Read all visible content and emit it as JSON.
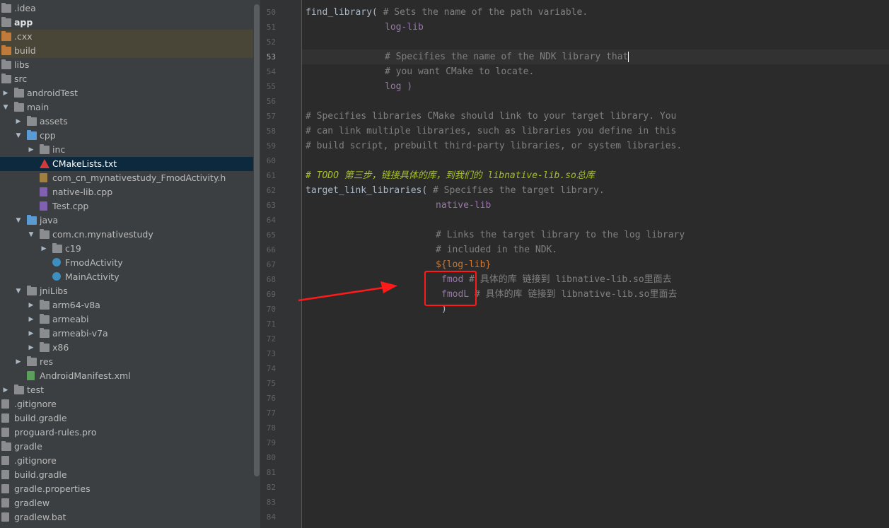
{
  "tree": {
    "items": [
      {
        "label": ".idea",
        "icon": "folder-icon",
        "arrow": ""
      },
      {
        "label": "app",
        "icon": "module-folder-icon",
        "arrow": "",
        "bold": true
      },
      {
        "label": ".cxx",
        "icon": "excluded-folder-icon",
        "arrow": ""
      },
      {
        "label": "build",
        "icon": "excluded-folder-icon",
        "arrow": ""
      },
      {
        "label": "libs",
        "icon": "folder-icon",
        "arrow": ""
      },
      {
        "label": "src",
        "icon": "folder-icon",
        "arrow": ""
      },
      {
        "label": "androidTest",
        "icon": "folder-icon",
        "arrow": "▶"
      },
      {
        "label": "main",
        "icon": "folder-icon",
        "arrow": "▼"
      },
      {
        "label": "assets",
        "icon": "resource-folder-icon",
        "arrow": "▶"
      },
      {
        "label": "cpp",
        "icon": "source-folder-icon",
        "arrow": "▼"
      },
      {
        "label": "inc",
        "icon": "package-folder-icon",
        "arrow": "▶"
      },
      {
        "label": "CMakeLists.txt",
        "icon": "cmake-icon",
        "arrow": ""
      },
      {
        "label": "com_cn_mynativestudy_FmodActivity.h",
        "icon": "header-file-icon",
        "arrow": ""
      },
      {
        "label": "native-lib.cpp",
        "icon": "cpp-file-icon",
        "arrow": ""
      },
      {
        "label": "Test.cpp",
        "icon": "cpp-file-icon",
        "arrow": ""
      },
      {
        "label": "java",
        "icon": "source-folder-icon",
        "arrow": "▼"
      },
      {
        "label": "com.cn.mynativestudy",
        "icon": "package-folder-icon",
        "arrow": "▼"
      },
      {
        "label": "c19",
        "icon": "package-folder-icon",
        "arrow": "▶"
      },
      {
        "label": "FmodActivity",
        "icon": "java-class-icon",
        "arrow": ""
      },
      {
        "label": "MainActivity",
        "icon": "java-class-icon",
        "arrow": ""
      },
      {
        "label": "jniLibs",
        "icon": "folder-icon",
        "arrow": "▼"
      },
      {
        "label": "arm64-v8a",
        "icon": "folder-icon",
        "arrow": "▶"
      },
      {
        "label": "armeabi",
        "icon": "folder-icon",
        "arrow": "▶"
      },
      {
        "label": "armeabi-v7a",
        "icon": "folder-icon",
        "arrow": "▶"
      },
      {
        "label": "x86",
        "icon": "folder-icon",
        "arrow": "▶"
      },
      {
        "label": "res",
        "icon": "resource-folder-icon",
        "arrow": "▶"
      },
      {
        "label": "AndroidManifest.xml",
        "icon": "manifest-file-icon",
        "arrow": ""
      },
      {
        "label": "test",
        "icon": "folder-icon",
        "arrow": "▶"
      },
      {
        "label": ".gitignore",
        "icon": "gitignore-file-icon",
        "arrow": ""
      },
      {
        "label": "build.gradle",
        "icon": "gradle-icon",
        "arrow": ""
      },
      {
        "label": "proguard-rules.pro",
        "icon": "text-file-icon",
        "arrow": ""
      },
      {
        "label": "gradle",
        "icon": "folder-icon",
        "arrow": ""
      },
      {
        "label": ".gitignore",
        "icon": "gitignore-file-icon",
        "arrow": ""
      },
      {
        "label": "build.gradle",
        "icon": "gradle-icon",
        "arrow": ""
      },
      {
        "label": "gradle.properties",
        "icon": "properties-file-icon",
        "arrow": ""
      },
      {
        "label": "gradlew",
        "icon": "text-file-icon",
        "arrow": ""
      },
      {
        "label": "gradlew.bat",
        "icon": "text-file-icon",
        "arrow": ""
      }
    ],
    "selected_label": "CMakeLists.txt"
  },
  "editor": {
    "line_numbers": [
      "50",
      "51",
      "52",
      "53",
      "54",
      "55",
      "56",
      "57",
      "58",
      "59",
      "60",
      "61",
      "62",
      "63",
      "64",
      "65",
      "66",
      "67",
      "68",
      "69",
      "70",
      "71",
      "72",
      "73",
      "74",
      "75",
      "76",
      "77",
      "78",
      "79",
      "80",
      "81",
      "82",
      "83",
      "84"
    ],
    "current_line": "53",
    "code": {
      "l50_fn": "find_library(",
      "l50_cm": " # Sets the name of the path variable.",
      "l51": "log-lib",
      "l53": "# Specifies the name of the NDK library that",
      "l54": "# you want CMake to locate.",
      "l55": "log )",
      "l57": "# Specifies libraries CMake should link to your target library. You",
      "l58": "# can link multiple libraries, such as libraries you define in this",
      "l59": "# build script, prebuilt third-party libraries, or system libraries.",
      "l61": "# TODO 第三步，链接具体的库，到我们的 libnative-lib.so总库",
      "l62_fn": "target_link_libraries(",
      "l62_cm": " # Specifies the target library.",
      "l63": "native-lib",
      "l65": "# Links the target library to the log library",
      "l66": "# included in the NDK.",
      "l67": "${log-lib}",
      "l68_lib": "fmod",
      "l68_cm": " # 具体的库 链接到 libnative-lib.so里面去",
      "l69_lib": "fmodL",
      "l69_cm": " # 具体的库 链接到 libnative-lib.so里面去",
      "l70": ")"
    }
  },
  "annotation": {
    "color": "#ff1a1a"
  },
  "colors": {
    "tree_bg": "#3c3f41",
    "editor_bg": "#2b2b2b",
    "selection": "#0d293e",
    "excluded_highlight": "#4a4637",
    "comment": "#808080",
    "string_arg": "#9876aa",
    "todo": "#a8c023"
  }
}
